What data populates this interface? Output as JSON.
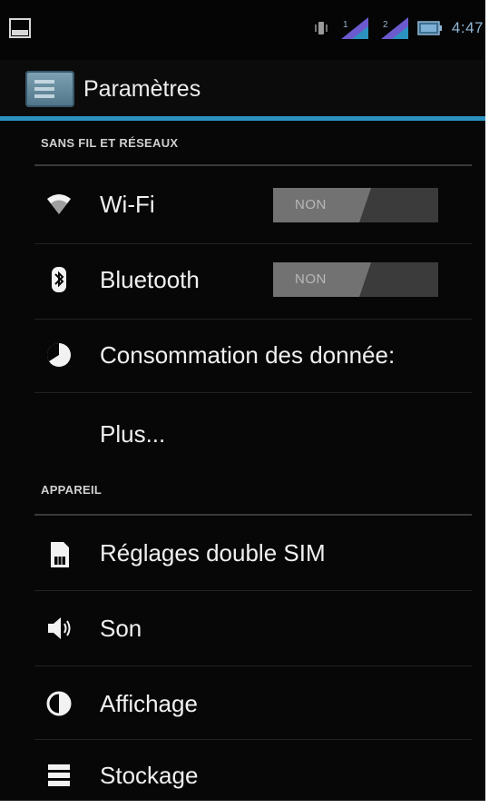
{
  "status_bar": {
    "time": "4:47",
    "icons": [
      "gallery-icon",
      "vibrate-icon",
      "signal-sim1-icon",
      "signal-sim2-icon",
      "battery-icon"
    ]
  },
  "action_bar": {
    "title": "Paramètres",
    "icon": "settings-app-icon"
  },
  "sections": {
    "wireless": {
      "header": "SANS FIL ET RÉSEAUX",
      "items": [
        {
          "label": "Wi-Fi",
          "icon": "wifi-icon",
          "toggle": "NON"
        },
        {
          "label": "Bluetooth",
          "icon": "bluetooth-icon",
          "toggle": "NON"
        },
        {
          "label": "Consommation des donnée:",
          "icon": "data-usage-icon"
        },
        {
          "label": "Plus..."
        }
      ]
    },
    "device": {
      "header": "APPAREIL",
      "items": [
        {
          "label": "Réglages double SIM",
          "icon": "sim-card-icon"
        },
        {
          "label": "Son",
          "icon": "speaker-icon"
        },
        {
          "label": "Affichage",
          "icon": "display-icon"
        },
        {
          "label": "Stockage",
          "icon": "storage-icon"
        }
      ]
    }
  },
  "colors": {
    "accent": "#2b92c0",
    "background": "#070707",
    "text": "#f0f0f0"
  }
}
